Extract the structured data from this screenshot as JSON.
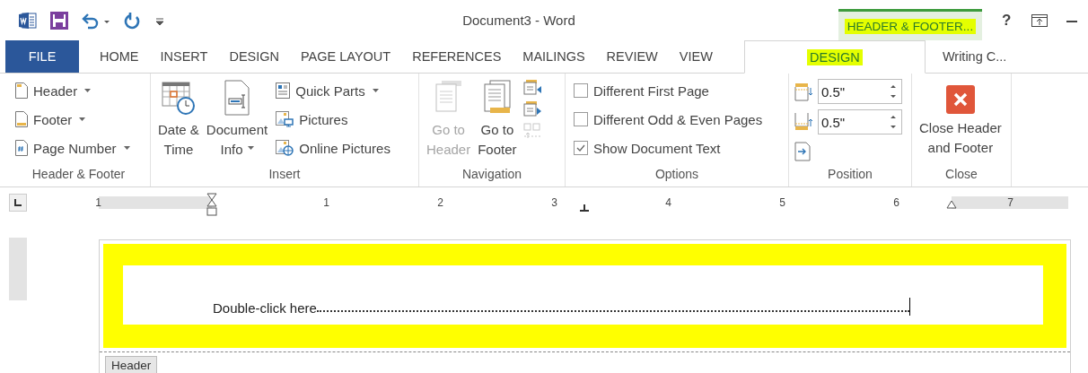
{
  "title": "Document3 - Word",
  "contextual_tab_group": {
    "label": "HEADER & FOOTER...",
    "highlighted": true
  },
  "help_button": "?",
  "tabs": [
    {
      "label": "FILE",
      "kind": "file",
      "selected": false,
      "highlighted": false
    },
    {
      "label": "HOME",
      "kind": "normal",
      "selected": false,
      "highlighted": false
    },
    {
      "label": "INSERT",
      "kind": "normal",
      "selected": false,
      "highlighted": false
    },
    {
      "label": "DESIGN",
      "kind": "normal",
      "selected": false,
      "highlighted": false
    },
    {
      "label": "PAGE LAYOUT",
      "kind": "normal",
      "selected": false,
      "highlighted": false
    },
    {
      "label": "REFERENCES",
      "kind": "normal",
      "selected": false,
      "highlighted": false
    },
    {
      "label": "MAILINGS",
      "kind": "normal",
      "selected": false,
      "highlighted": false
    },
    {
      "label": "REVIEW",
      "kind": "normal",
      "selected": false,
      "highlighted": false
    },
    {
      "label": "VIEW",
      "kind": "normal",
      "selected": false,
      "highlighted": false
    },
    {
      "label": "DESIGN",
      "kind": "context",
      "selected": true,
      "highlighted": true
    },
    {
      "label": "Writing C...",
      "kind": "normal",
      "selected": false,
      "highlighted": false
    }
  ],
  "ribbon_groups": [
    {
      "label": "Header & Footer",
      "kind": "menus",
      "items": [
        {
          "kind": "header",
          "label": "Header",
          "dropdown": true
        },
        {
          "kind": "footer",
          "label": "Footer",
          "dropdown": true
        },
        {
          "kind": "page-number",
          "label": "Page Number",
          "dropdown": true
        }
      ]
    },
    {
      "label": "Insert",
      "kind": "insert",
      "large": [
        {
          "kind": "date-time",
          "lines": [
            "Date &",
            "Time"
          ],
          "dropdown": false
        },
        {
          "kind": "document-info",
          "lines": [
            "Document",
            "Info"
          ],
          "dropdown": true
        }
      ],
      "items": [
        {
          "kind": "quick-parts",
          "label": "Quick Parts",
          "dropdown": true
        },
        {
          "kind": "pictures",
          "label": "Pictures",
          "dropdown": false
        },
        {
          "kind": "online-pictures",
          "label": "Online Pictures",
          "dropdown": false
        }
      ]
    },
    {
      "label": "Navigation",
      "kind": "navigation",
      "large": [
        {
          "kind": "go-to-header",
          "lines": [
            "Go to",
            "Header"
          ],
          "disabled": true
        },
        {
          "kind": "go-to-footer",
          "lines": [
            "Go to",
            "Footer"
          ],
          "disabled": false
        }
      ],
      "small": [
        {
          "kind": "previous",
          "disabled": false
        },
        {
          "kind": "next",
          "disabled": false
        },
        {
          "kind": "link",
          "disabled": true
        }
      ]
    },
    {
      "label": "Options",
      "kind": "options",
      "checkboxes": [
        {
          "label": "Different First Page",
          "checked": false
        },
        {
          "label": "Different Odd & Even Pages",
          "checked": false
        },
        {
          "label": "Show Document Text",
          "checked": true
        }
      ]
    },
    {
      "label": "Position",
      "kind": "position",
      "spinners": [
        {
          "kind": "header-top",
          "value": "0.5\""
        },
        {
          "kind": "footer-bottom",
          "value": "0.5\""
        }
      ]
    },
    {
      "label": "Close",
      "kind": "close",
      "lines": [
        "Close Header",
        "and Footer"
      ]
    }
  ],
  "ruler": {
    "labels": [
      "1",
      "1",
      "2",
      "3",
      "4",
      "5",
      "6",
      "7"
    ]
  },
  "document": {
    "header_prompt": "Double-click here",
    "header_tag": "Header",
    "highlighted": true
  }
}
